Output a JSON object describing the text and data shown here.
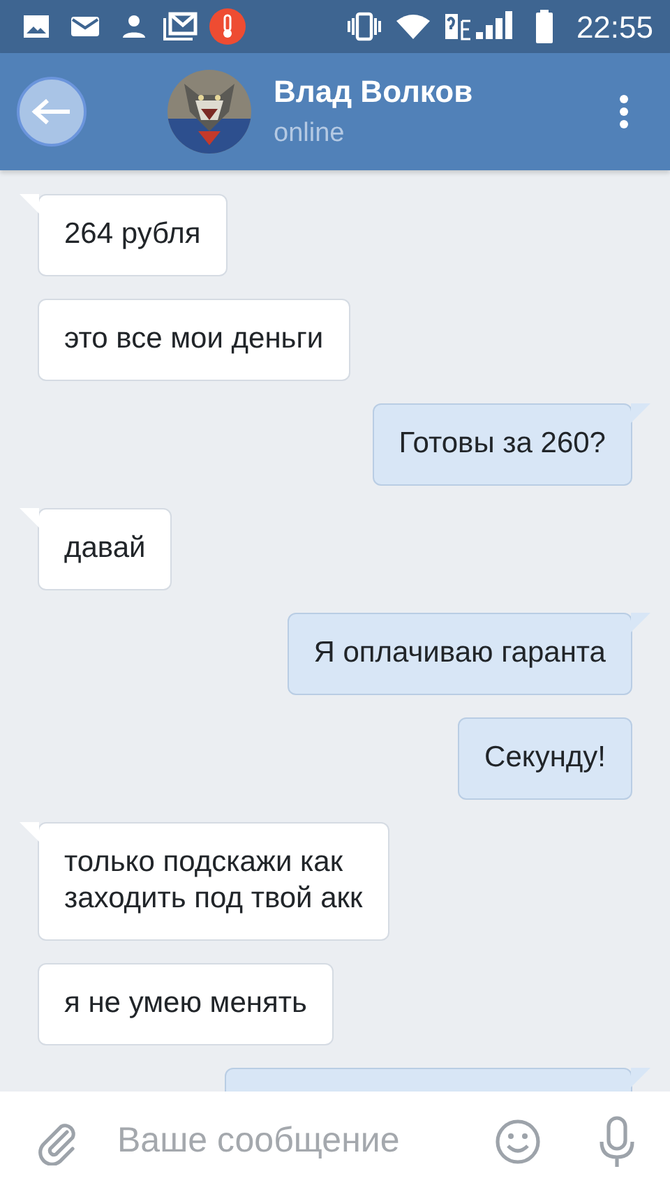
{
  "status_bar": {
    "time": "22:55"
  },
  "header": {
    "name": "Влад Волков",
    "status": "online"
  },
  "messages": [
    {
      "outgoing": false,
      "tail": true,
      "text": "264 рубля"
    },
    {
      "outgoing": false,
      "tail": false,
      "text": "это все мои деньги"
    },
    {
      "outgoing": true,
      "tail": true,
      "text": "Готовы за 260?"
    },
    {
      "outgoing": false,
      "tail": true,
      "text": "давай"
    },
    {
      "outgoing": true,
      "tail": true,
      "text": "Я оплачиваю гаранта"
    },
    {
      "outgoing": true,
      "tail": false,
      "text": "Секунду!"
    },
    {
      "outgoing": false,
      "tail": true,
      "text": "только подскажи как\nзаходить под твой акк"
    },
    {
      "outgoing": false,
      "tail": false,
      "text": "я не умею менять"
    }
  ],
  "clipped_message": {
    "outgoing": true,
    "tail": true
  },
  "composer": {
    "placeholder": "Ваше сообщение"
  }
}
